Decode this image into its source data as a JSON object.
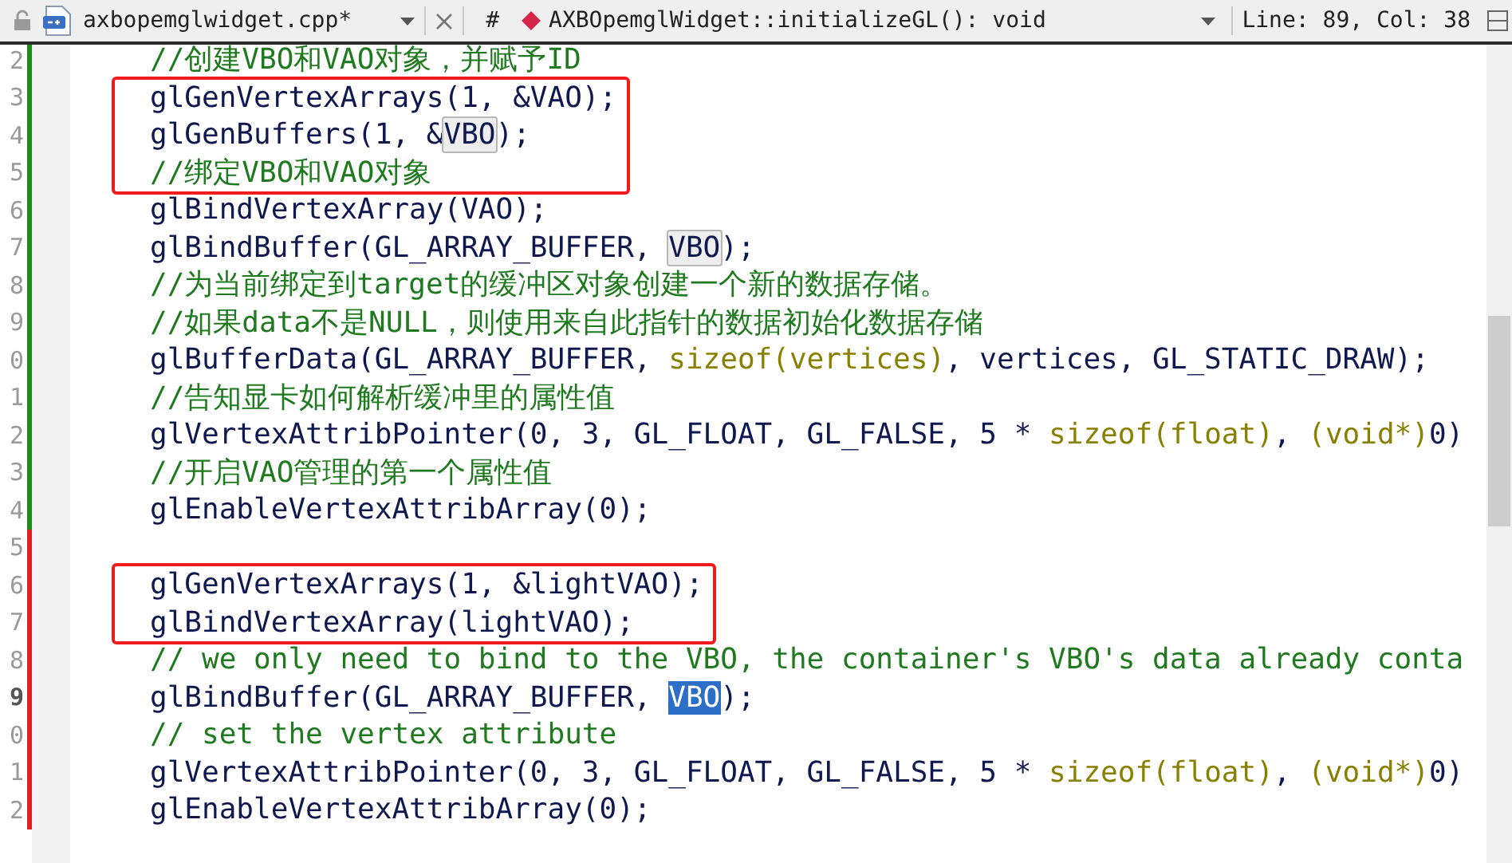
{
  "editor_toolbar": {
    "file_name": "axbopemglwidget.cpp*",
    "symbol_prefix": "#",
    "symbol": "AXBOpemglWidget::initializeGL(): void",
    "cursor_position": "Line: 89, Col: 38"
  },
  "blocks": [
    {
      "kind": "plain",
      "lines": [
        {
          "number": "2",
          "modified": false,
          "current": false,
          "tokens": [
            {
              "kind": "comment",
              "text": "//创建VBO和VAO对象，并赋予ID"
            }
          ]
        }
      ]
    },
    {
      "kind": "boxed",
      "lines": [
        {
          "number": "3",
          "modified": false,
          "current": false,
          "tokens": [
            {
              "kind": "code",
              "text": "glGenVertexArrays(1, &VAO);"
            }
          ]
        },
        {
          "number": "4",
          "modified": false,
          "current": false,
          "tokens": [
            {
              "kind": "code",
              "text": "glGenBuffers(1, &"
            },
            {
              "kind": "occurrence",
              "text": "VBO"
            },
            {
              "kind": "code",
              "text": ");"
            }
          ]
        },
        {
          "number": "5",
          "modified": false,
          "current": false,
          "tokens": [
            {
              "kind": "comment",
              "text": "//绑定VBO和VAO对象"
            }
          ]
        }
      ]
    },
    {
      "kind": "plain",
      "lines": [
        {
          "number": "6",
          "modified": false,
          "current": false,
          "tokens": [
            {
              "kind": "code",
              "text": "glBindVertexArray(VAO);"
            }
          ]
        },
        {
          "number": "7",
          "modified": false,
          "current": false,
          "tokens": [
            {
              "kind": "code",
              "text": "glBindBuffer(GL_ARRAY_BUFFER, "
            },
            {
              "kind": "occurrence",
              "text": "VBO"
            },
            {
              "kind": "code",
              "text": ");"
            }
          ]
        },
        {
          "number": "8",
          "modified": false,
          "current": false,
          "tokens": [
            {
              "kind": "comment",
              "text": "//为当前绑定到target的缓冲区对象创建一个新的数据存储。"
            }
          ]
        },
        {
          "number": "9",
          "modified": false,
          "current": false,
          "tokens": [
            {
              "kind": "comment",
              "text": "//如果data不是NULL，则使用来自此指针的数据初始化数据存储"
            }
          ]
        },
        {
          "number": "0",
          "modified": false,
          "current": false,
          "tokens": [
            {
              "kind": "code",
              "text": "glBufferData(GL_ARRAY_BUFFER, "
            },
            {
              "kind": "keyword",
              "text": "sizeof(vertices)"
            },
            {
              "kind": "code",
              "text": ", vertices, GL_STATIC_DRAW);"
            }
          ]
        },
        {
          "number": "1",
          "modified": false,
          "current": false,
          "tokens": [
            {
              "kind": "comment",
              "text": "//告知显卡如何解析缓冲里的属性值"
            }
          ]
        },
        {
          "number": "2",
          "modified": false,
          "current": false,
          "tokens": [
            {
              "kind": "code",
              "text": "glVertexAttribPointer(0, 3, GL_FLOAT, GL_FALSE, 5 * "
            },
            {
              "kind": "keyword",
              "text": "sizeof(float)"
            },
            {
              "kind": "code",
              "text": ", "
            },
            {
              "kind": "keyword",
              "text": "(void*)"
            },
            {
              "kind": "code",
              "text": "0)"
            }
          ]
        },
        {
          "number": "3",
          "modified": false,
          "current": false,
          "tokens": [
            {
              "kind": "comment",
              "text": "//开启VAO管理的第一个属性值"
            }
          ]
        },
        {
          "number": "4",
          "modified": false,
          "current": false,
          "tokens": [
            {
              "kind": "code",
              "text": "glEnableVertexAttribArray(0);"
            }
          ]
        },
        {
          "number": "5",
          "modified": true,
          "current": false
        }
      ]
    },
    {
      "kind": "boxed",
      "lines": [
        {
          "number": "6",
          "modified": true,
          "current": false,
          "tokens": [
            {
              "kind": "code",
              "text": "glGenVertexArrays(1, &lightVAO);"
            }
          ]
        },
        {
          "number": "7",
          "modified": true,
          "current": false,
          "tokens": [
            {
              "kind": "code",
              "text": "glBindVertexArray(lightVAO);"
            }
          ]
        }
      ]
    },
    {
      "kind": "plain",
      "lines": [
        {
          "number": "8",
          "modified": true,
          "current": false,
          "tokens": [
            {
              "kind": "comment",
              "text": "// we only need to bind to the VBO, the container's VBO's data already conta"
            }
          ]
        },
        {
          "number": "9",
          "modified": true,
          "current": true,
          "tokens": [
            {
              "kind": "code",
              "text": "glBindBuffer(GL_ARRAY_BUFFER, "
            },
            {
              "kind": "selection",
              "text": "VBO"
            },
            {
              "kind": "code",
              "text": ");"
            }
          ]
        },
        {
          "number": "0",
          "modified": true,
          "current": false,
          "tokens": [
            {
              "kind": "comment",
              "text": "// set the vertex attribute"
            }
          ]
        },
        {
          "number": "1",
          "modified": true,
          "current": false,
          "tokens": [
            {
              "kind": "code",
              "text": "glVertexAttribPointer(0, 3, GL_FLOAT, GL_FALSE, 5 * "
            },
            {
              "kind": "keyword",
              "text": "sizeof(float)"
            },
            {
              "kind": "code",
              "text": ", "
            },
            {
              "kind": "keyword",
              "text": "(void*)"
            },
            {
              "kind": "code",
              "text": "0)"
            }
          ]
        },
        {
          "number": "2",
          "modified": true,
          "current": false,
          "tokens": [
            {
              "kind": "code",
              "text": "glEnableVertexAttribArray(0);"
            }
          ]
        }
      ]
    }
  ]
}
